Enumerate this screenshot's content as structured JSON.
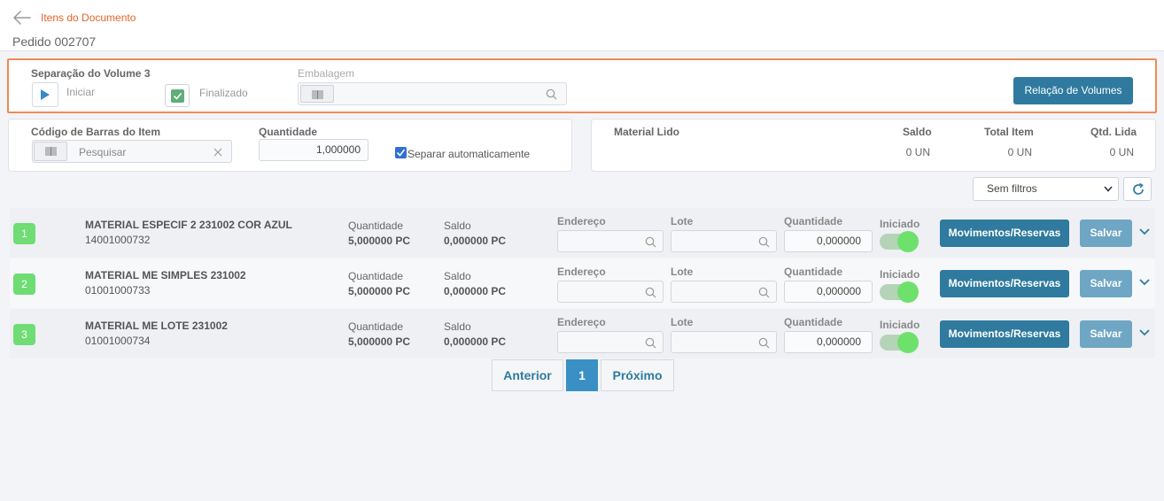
{
  "header": {
    "breadcrumb": "Itens do Documento",
    "title": "Pedido 002707"
  },
  "volume": {
    "title": "Separação do Volume 3",
    "start_label": "Iniciar",
    "finished_label": "Finalizado",
    "packaging_label": "Embalagem",
    "volumes_button": "Relação de Volumes"
  },
  "scan": {
    "barcode_label": "Código de Barras do Item",
    "search_placeholder": "Pesquisar",
    "quantity_label": "Quantidade",
    "quantity_value": "1,000000",
    "auto_label": "Separar automaticamente"
  },
  "summary": {
    "material_label": "Material Lido",
    "balance_label": "Saldo",
    "total_label": "Total Item",
    "read_label": "Qtd. Lida",
    "balance_value": "0 UN",
    "total_value": "0 UN",
    "read_value": "0 UN"
  },
  "filter": {
    "selected": "Sem filtros"
  },
  "columns": {
    "quantity": "Quantidade",
    "balance": "Saldo",
    "address": "Endereço",
    "lot": "Lote",
    "quantity2": "Quantidade",
    "started": "Iniciado"
  },
  "actions": {
    "movements": "Movimentos/Reservas",
    "save": "Salvar"
  },
  "items": [
    {
      "num": "1",
      "name": "MATERIAL ESPECIF 2 231002 COR AZUL",
      "code": "14001000732",
      "quantity": "5,000000 PC",
      "balance": "0,000000 PC",
      "qty_value": "0,000000"
    },
    {
      "num": "2",
      "name": "MATERIAL ME SIMPLES 231002",
      "code": "01001000733",
      "quantity": "5,000000 PC",
      "balance": "0,000000 PC",
      "qty_value": "0,000000"
    },
    {
      "num": "3",
      "name": "MATERIAL ME LOTE 231002",
      "code": "01001000734",
      "quantity": "5,000000 PC",
      "balance": "0,000000 PC",
      "qty_value": "0,000000"
    }
  ],
  "pager": {
    "prev": "Anterior",
    "page": "1",
    "next": "Próximo"
  },
  "colors": {
    "accent": "#e8622a",
    "primary": "#2f7a9e",
    "badge": "#6fdc74",
    "save": "#6ea6c4"
  }
}
